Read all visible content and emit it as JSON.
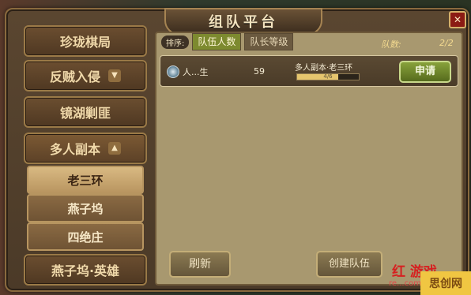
{
  "title": "组队平台",
  "close_icon": "close-icon",
  "sidebar": {
    "categories": [
      {
        "label": "珍珑棋局",
        "open": false
      },
      {
        "label": "反贼入侵",
        "open": false,
        "arrow": "▼"
      },
      {
        "label": "镜湖剿匪",
        "open": false
      },
      {
        "label": "多人副本",
        "open": true,
        "arrow": "▲"
      }
    ],
    "subitems": [
      "老三环",
      "燕子坞",
      "四绝庄"
    ],
    "active_subitem": "老三环",
    "bottom_category": "燕子坞·英雄"
  },
  "toolbar": {
    "sort_label": "排序:",
    "tabs": [
      {
        "label": "队伍人数",
        "active": true
      },
      {
        "label": "队长等级",
        "active": false
      }
    ],
    "count_label": "队数:",
    "count_value": "2/2"
  },
  "teams": [
    {
      "leader": "人...生",
      "level": "59",
      "dungeon": "多人副本·老三环",
      "progress_label": "4/6",
      "progress": 0.67,
      "apply_label": "申请"
    }
  ],
  "buttons": {
    "refresh": "刷新",
    "create": "创建队伍"
  },
  "watermark": {
    "text": "红 游戏",
    "url": "re...com",
    "corner": "思创网"
  },
  "colors": {
    "accent_green": "#7d8a2f",
    "gold": "#e6c66e",
    "frame_brown": "#5a4630"
  }
}
